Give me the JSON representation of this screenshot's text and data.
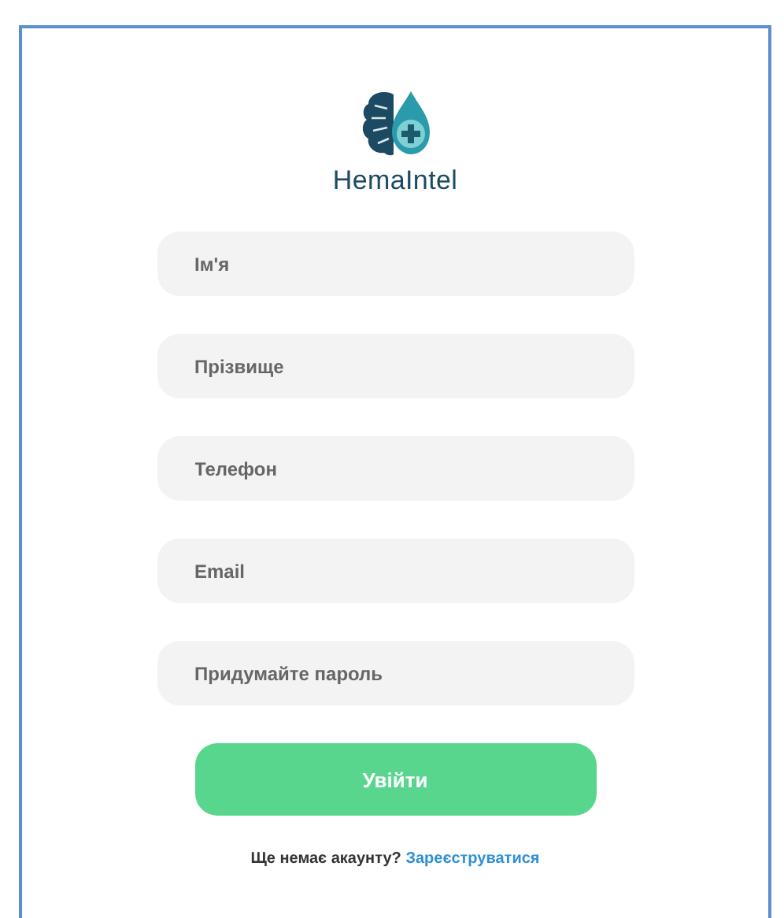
{
  "brand": {
    "name": "HemaIntel"
  },
  "fields": [
    {
      "placeholder": "Ім'я"
    },
    {
      "placeholder": "Прізвище"
    },
    {
      "placeholder": "Телефон"
    },
    {
      "placeholder": "Email"
    },
    {
      "placeholder": "Придумайте пароль"
    }
  ],
  "submit": {
    "label": "Увійти"
  },
  "footer": {
    "text": "Ще немає акаунту?",
    "link": "Зареєструватися"
  }
}
